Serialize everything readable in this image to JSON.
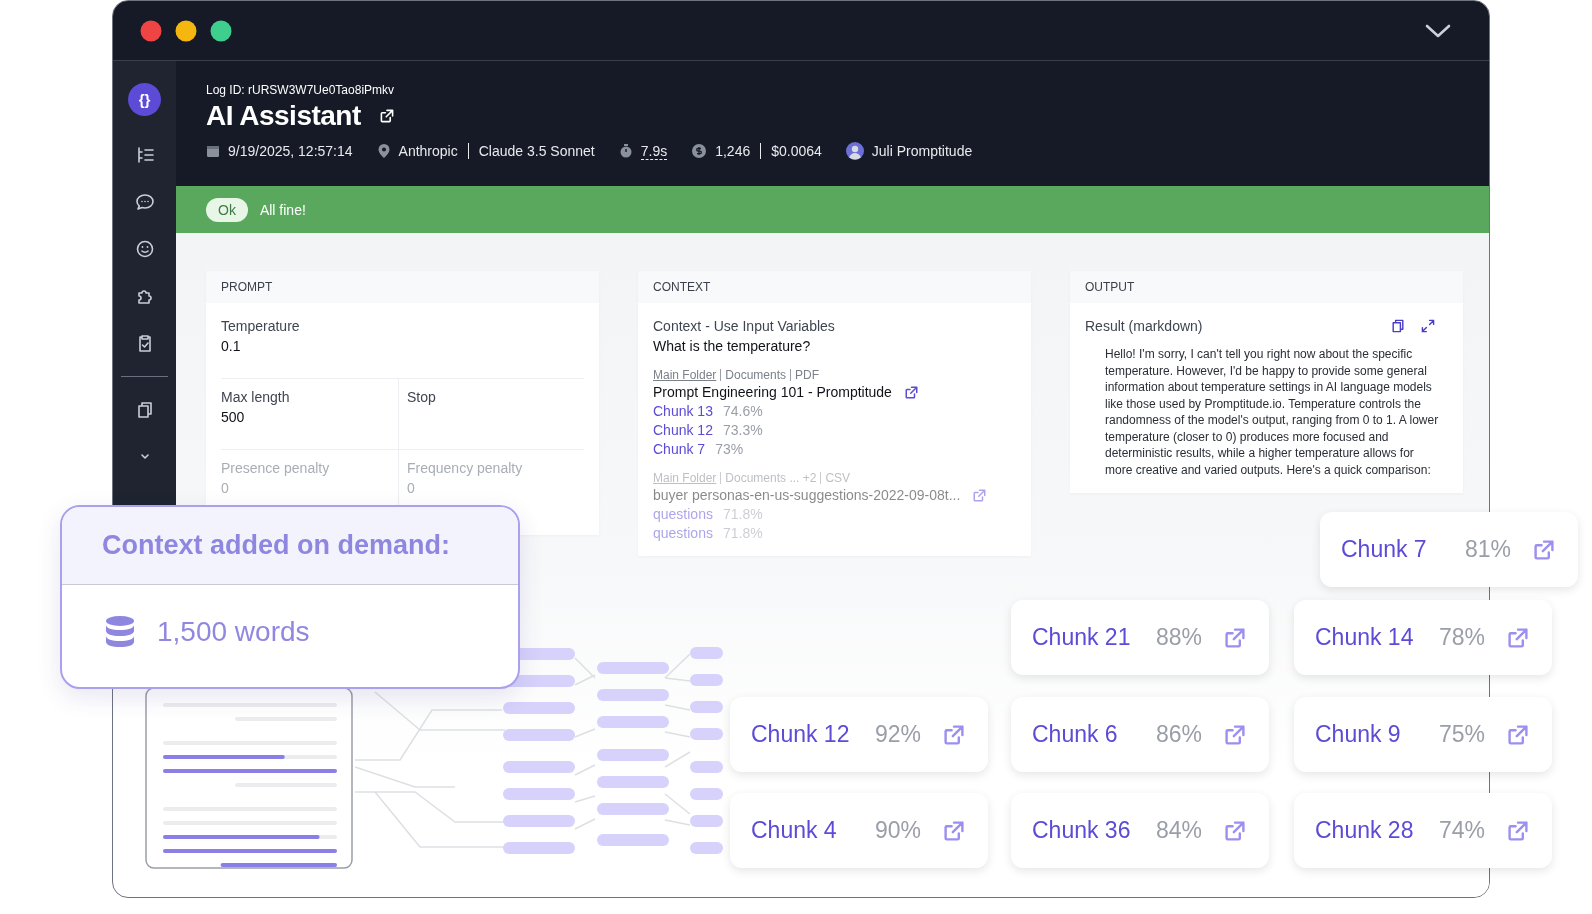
{
  "window": {
    "logo": "{}"
  },
  "header": {
    "log_id": "Log ID: rURSW3W7Ue0Tao8iPmkv",
    "title": "AI Assistant",
    "date": "9/19/2025, 12:57:14",
    "provider": "Anthropic",
    "model": "Claude 3.5 Sonnet",
    "duration": "7.9s",
    "tokens": "1,246",
    "cost": "$0.0064",
    "user": "Juli Promptitude"
  },
  "status": {
    "badge": "Ok",
    "message": "All fine!"
  },
  "prompt": {
    "title": "PROMPT",
    "rows": [
      [
        {
          "label": "Temperature",
          "value": "0.1",
          "disabled": false
        }
      ],
      [
        {
          "label": "Max length",
          "value": "500",
          "disabled": false
        },
        {
          "label": "Stop",
          "disabled": false
        }
      ],
      [
        {
          "label": "Presence penalty",
          "value": "0",
          "disabled": true
        },
        {
          "label": "Frequency penalty",
          "value": "0",
          "disabled": true
        }
      ]
    ]
  },
  "context": {
    "title": "CONTEXT",
    "heading": "Context - Use Input Variables",
    "question": "What is the temperature?",
    "sources": [
      {
        "path": [
          "Main Folder",
          "Documents",
          "PDF"
        ],
        "name": "Prompt Engineering 101 - Promptitude",
        "chunks": [
          {
            "label": "Chunk 13",
            "score": "74.6%"
          },
          {
            "label": "Chunk 12",
            "score": "73.3%"
          },
          {
            "label": "Chunk 7",
            "score": "73%"
          }
        ]
      },
      {
        "path": [
          "Main Folder",
          "Documents ... +2",
          "CSV"
        ],
        "name": "buyer personas-en-us-suggestions-2022-09-08t...",
        "chunks": [
          {
            "label": "questions",
            "score": "71.8%"
          },
          {
            "label": "questions",
            "score": "71.8%"
          }
        ]
      }
    ]
  },
  "output": {
    "title": "OUTPUT",
    "label": "Result (markdown)",
    "text": "Hello! I'm sorry, I can't tell you right now about the specific temperature. However, I'd be happy to provide some general information about temperature settings in AI language models like those used by Promptitude.io. Temperature controls the randomness of the model's output, ranging from 0 to 1. A lower temperature (closer to 0) produces more focused and deterministic results, while a higher temperature allows for more creative and varied outputs. Here's a quick comparison:"
  },
  "context_card": {
    "title": "Context added on demand:",
    "words": "1,500 words"
  },
  "chunk_cards": [
    {
      "label": "Chunk 7",
      "score": "81%"
    },
    {
      "label": "Chunk 21",
      "score": "88%"
    },
    {
      "label": "Chunk 14",
      "score": "78%"
    },
    {
      "label": "Chunk 12",
      "score": "92%"
    },
    {
      "label": "Chunk 6",
      "score": "86%"
    },
    {
      "label": "Chunk 9",
      "score": "75%"
    },
    {
      "label": "Chunk 4",
      "score": "90%"
    },
    {
      "label": "Chunk 36",
      "score": "84%"
    },
    {
      "label": "Chunk 28",
      "score": "74%"
    }
  ]
}
